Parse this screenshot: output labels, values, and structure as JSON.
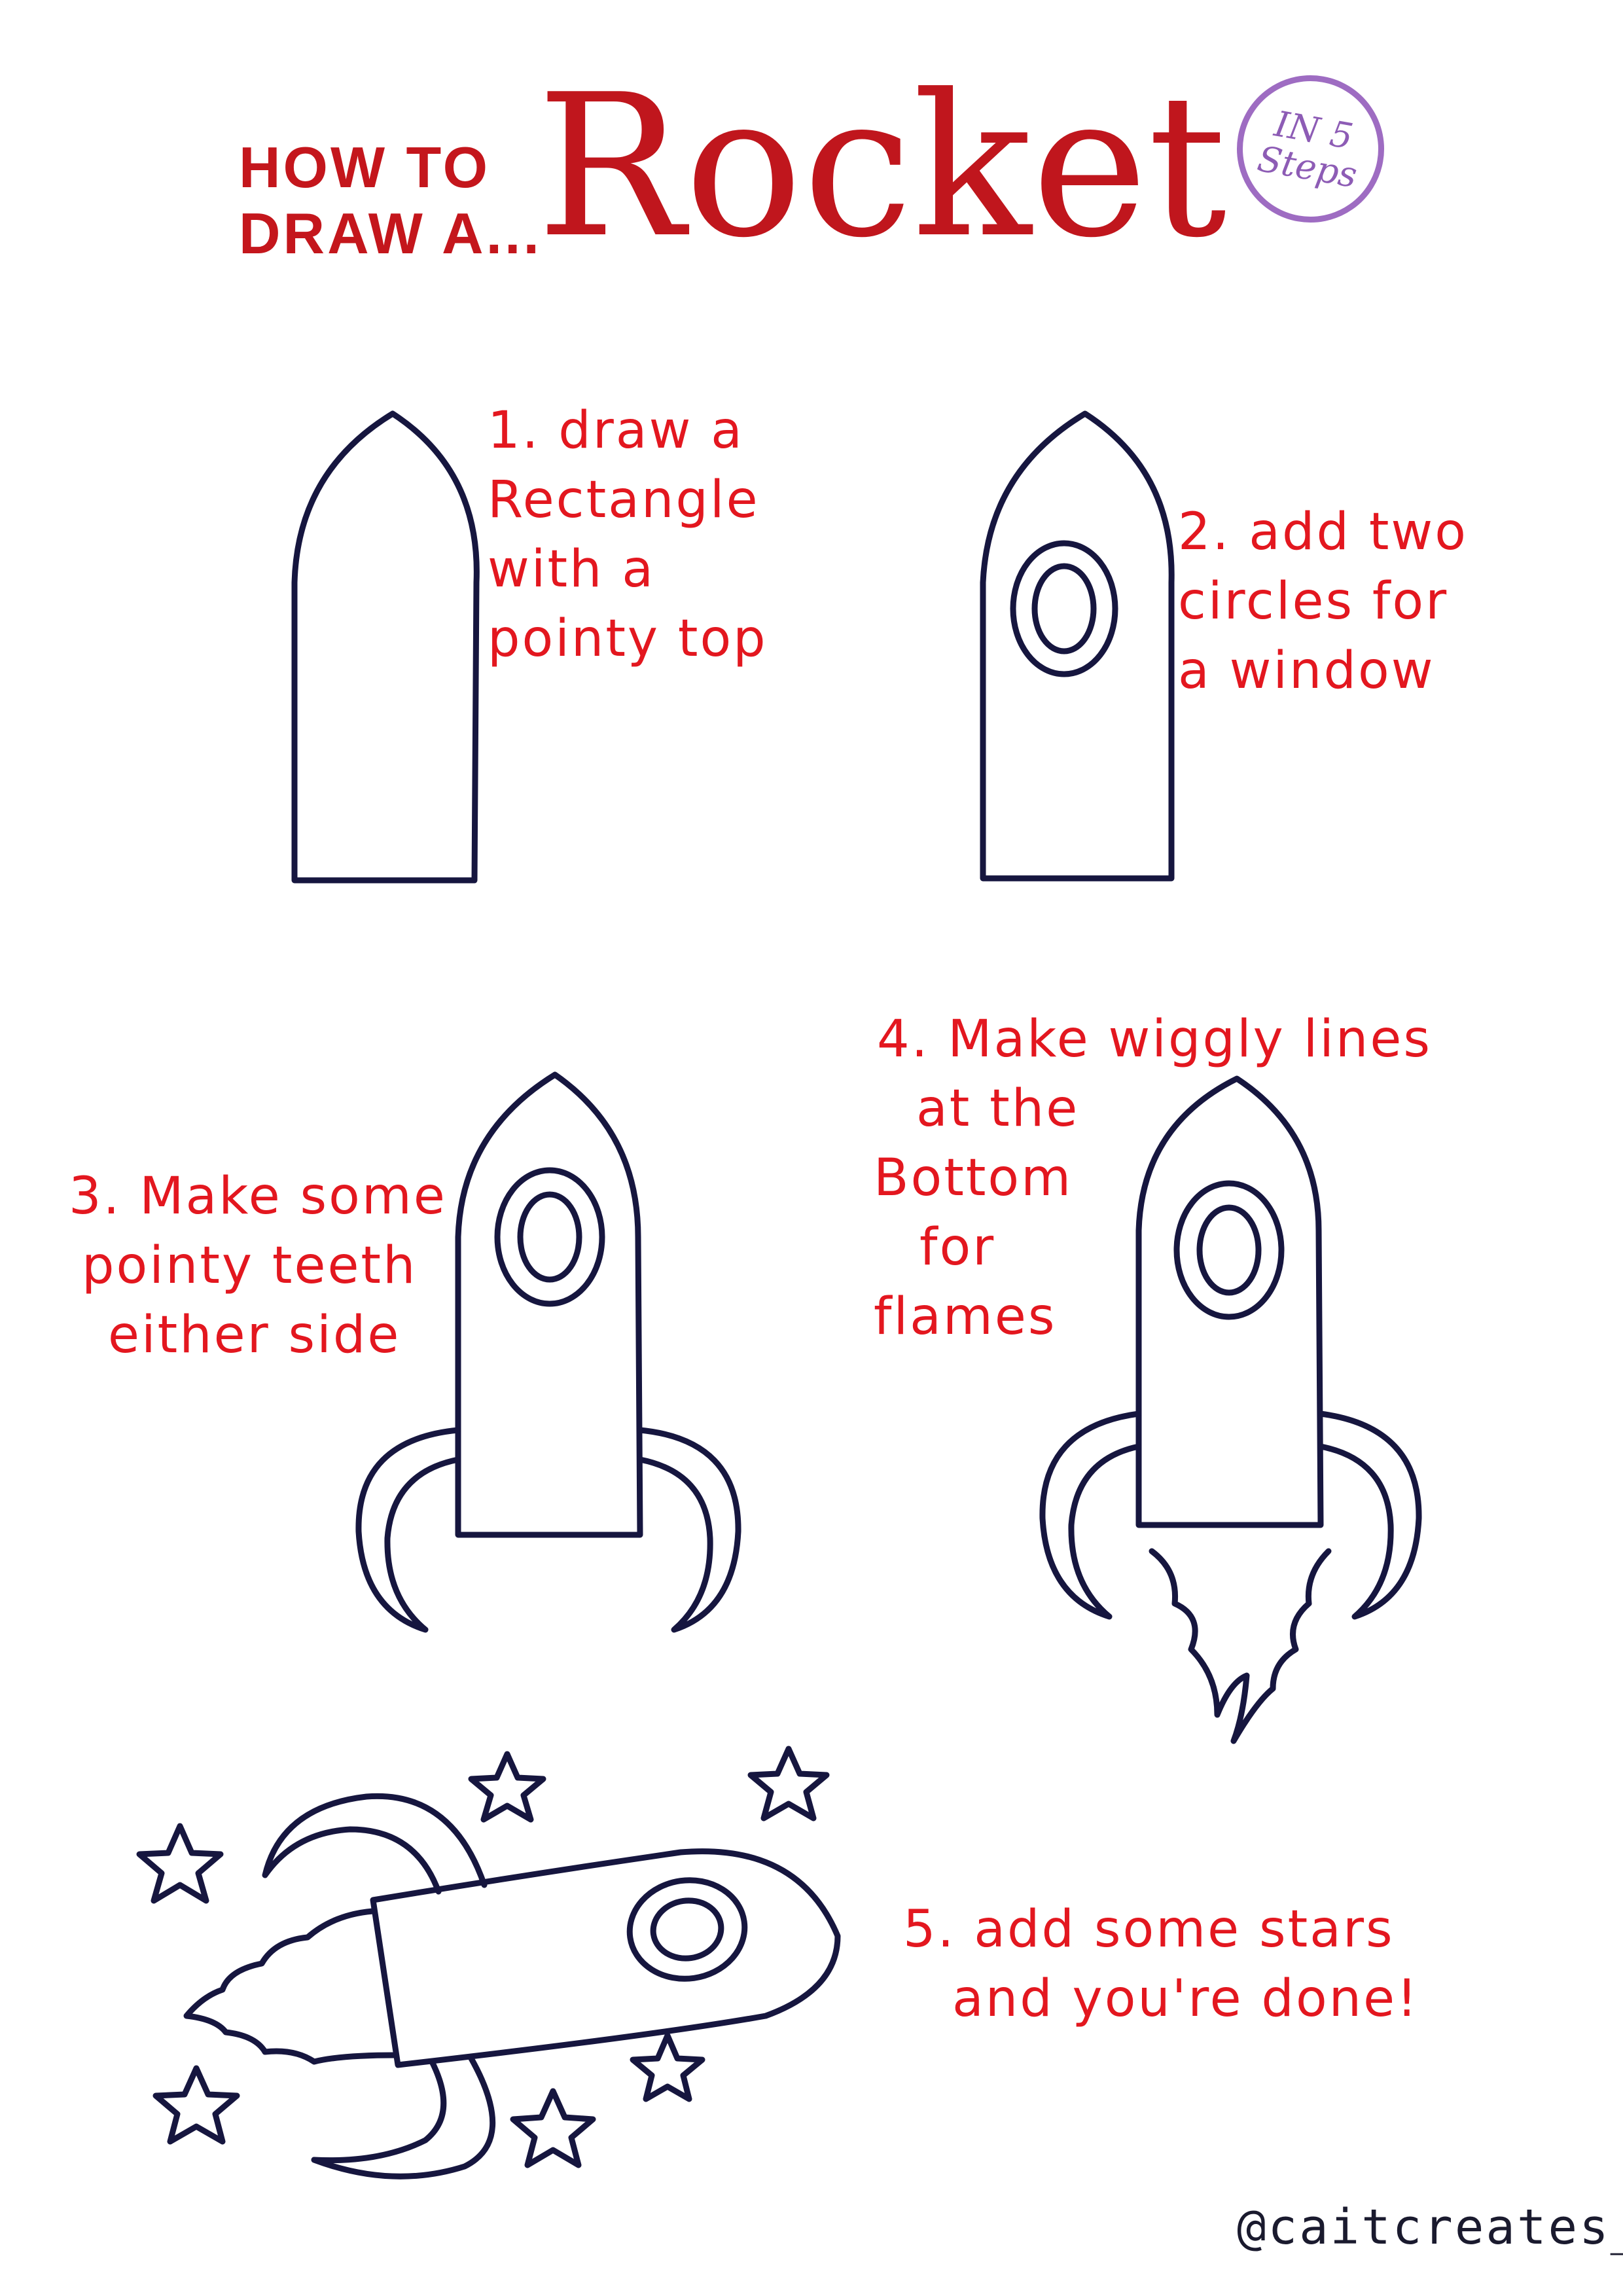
{
  "title": {
    "prefix_line1": "HOW TO",
    "prefix_line2": "DRAW A...",
    "main": "Rocket",
    "badge_line1": "IN 5",
    "badge_line2": "Steps"
  },
  "steps": [
    {
      "lines": [
        "1. draw a",
        "Rectangle",
        "with a",
        "pointy top"
      ]
    },
    {
      "lines": [
        "2. add two",
        "circles for",
        "a window"
      ]
    },
    {
      "lines": [
        "3. Make some",
        "pointy teeth",
        "either side"
      ]
    },
    {
      "lines": [
        "4. Make wiggly lines",
        "at the",
        "Bottom",
        "for",
        "flames"
      ]
    },
    {
      "lines": [
        "5. add some stars",
        "and you're done!"
      ]
    }
  ],
  "credit": "@caitcreates_",
  "colors": {
    "text_red": "#e3171f",
    "title_red": "#c0161d",
    "badge_purple": "#9e6cc2",
    "ink_navy": "#16163f"
  }
}
